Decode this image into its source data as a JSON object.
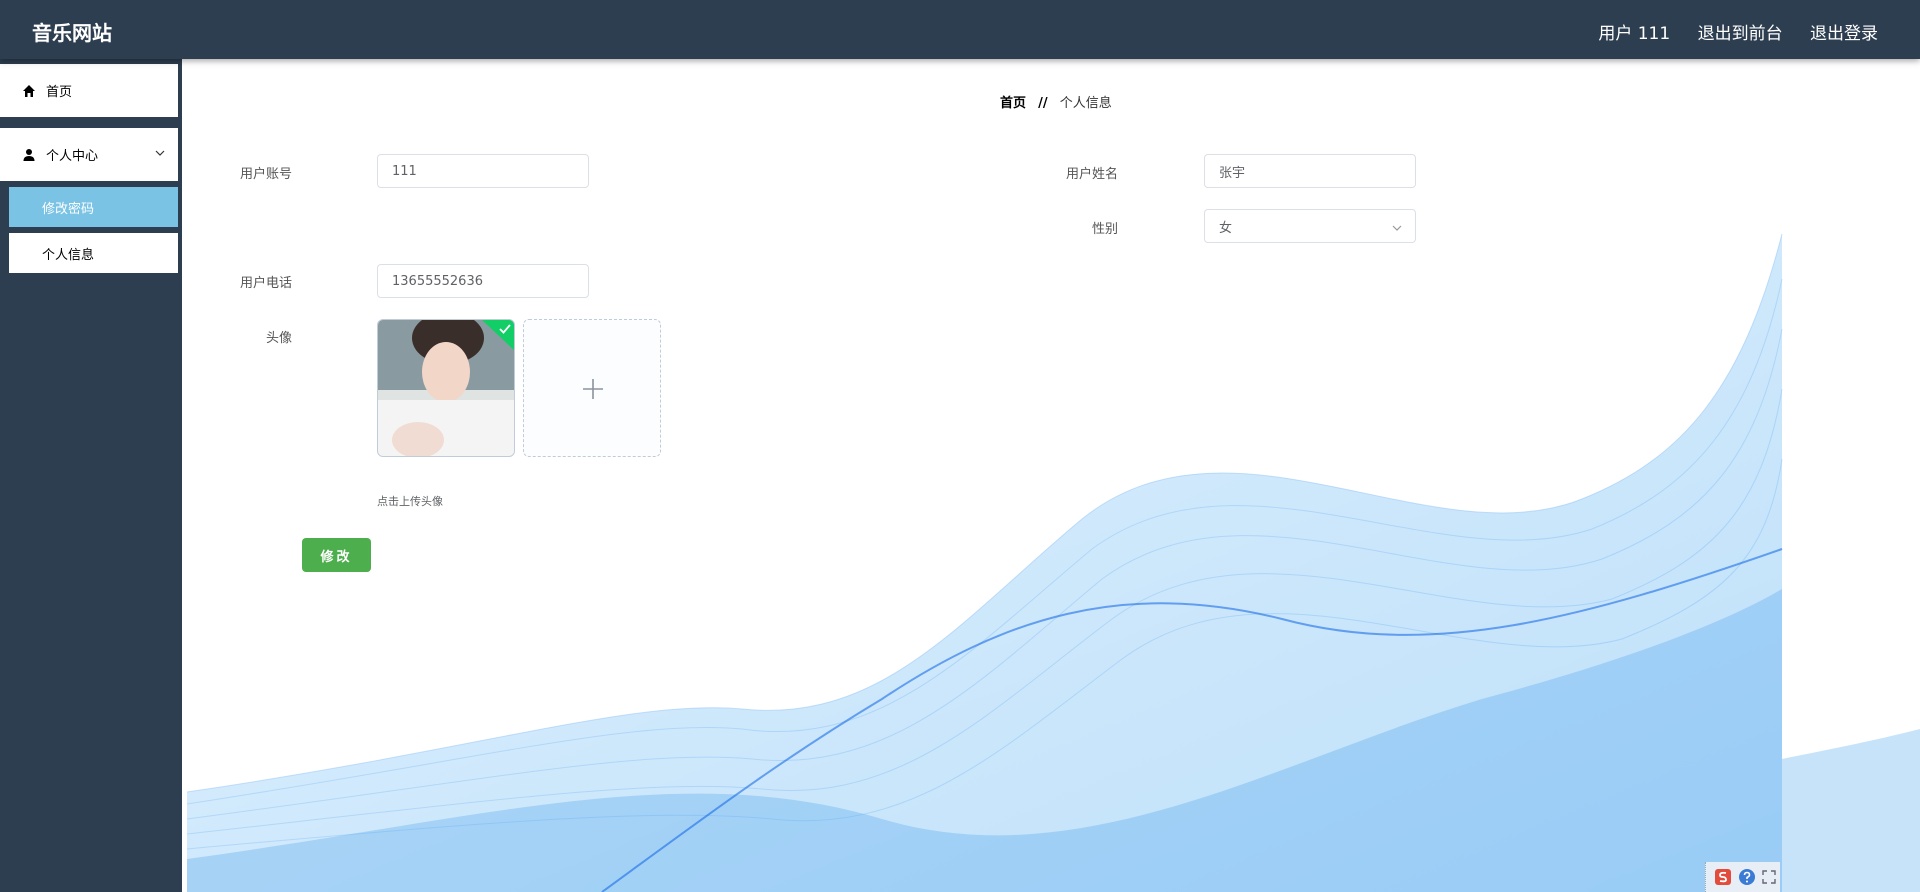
{
  "header": {
    "site_title": "音乐网站",
    "user_label": "用户 111",
    "back_to_front": "退出到前台",
    "logout": "退出登录"
  },
  "sidebar": {
    "home": "首页",
    "personal_center": "个人中心",
    "sub_items": [
      "修改密码",
      "个人信息"
    ]
  },
  "breadcrumb": {
    "home": "首页",
    "separator": "//",
    "current": "个人信息"
  },
  "form": {
    "account_label": "用户账号",
    "account_value": "111",
    "name_label": "用户姓名",
    "name_value": "张宇",
    "gender_label": "性别",
    "gender_value": "女",
    "phone_label": "用户电话",
    "phone_value": "13655552636",
    "avatar_label": "头像",
    "upload_tip": "点击上传头像",
    "submit_label": "修改"
  },
  "colors": {
    "header_bg": "#2d3e50",
    "active_menu": "#7ac3e5",
    "submit": "#4cae4c",
    "upload_success": "#13ce66"
  },
  "icons": {
    "home": "home-icon",
    "user": "user-icon",
    "chevron": "chevron-down-icon",
    "plus": "plus-icon",
    "check": "check-icon"
  }
}
